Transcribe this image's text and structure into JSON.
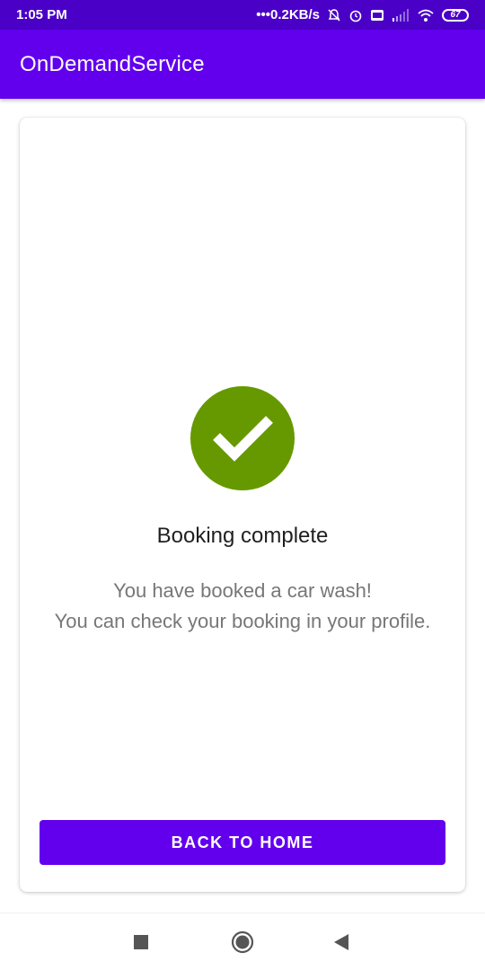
{
  "status_bar": {
    "time": "1:05 PM",
    "net_speed": "•••0.2KB/s",
    "battery": "67",
    "icons": [
      "mute-notification-icon",
      "alarm-icon",
      "volte-icon",
      "signal-icon",
      "wifi-icon",
      "battery-icon"
    ]
  },
  "app_bar": {
    "title": "OnDemandService"
  },
  "confirmation": {
    "icon": "checkmark-icon",
    "title": "Booking complete",
    "message_line1": "You have booked a car wash!",
    "message_line2": "You can check your booking in your profile.",
    "button_label": "BACK TO HOME"
  },
  "nav_bar": {
    "items": [
      "recents-square-icon",
      "home-circle-icon",
      "back-triangle-icon"
    ]
  },
  "colors": {
    "status_bar": "#4a00c7",
    "app_bar": "#6200ee",
    "button": "#6200ee",
    "success": "#669900",
    "nav_icon": "#555555"
  }
}
